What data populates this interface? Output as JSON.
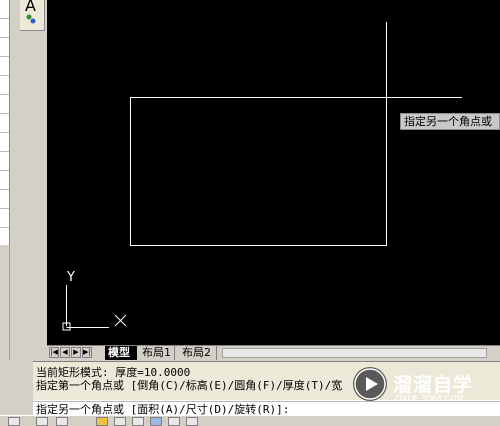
{
  "toolbar": {
    "text_tool_letter": "A"
  },
  "canvas": {
    "bg_color": "#000000",
    "line_color": "#ffffff",
    "prompt_tooltip": "指定另一个角点或",
    "ucs": {
      "y_label": "Y",
      "x_label": "X"
    }
  },
  "tabs": [
    {
      "label": "模型",
      "active": true
    },
    {
      "label": "布局1",
      "active": false
    },
    {
      "label": "布局2",
      "active": false
    }
  ],
  "nav_buttons": [
    "first",
    "prev",
    "next",
    "last"
  ],
  "command": {
    "history": [
      "当前矩形模式:  厚度=10.0000",
      "指定第一个角点或 [倒角(C)/标高(E)/圆角(F)/厚度(T)/宽"
    ],
    "current": "指定另一个角点或 [面积(A)/尺寸(D)/旋转(R)]:"
  },
  "watermark": {
    "title": "溜溜自学",
    "url": "ZIXUE.3D66.COM"
  }
}
